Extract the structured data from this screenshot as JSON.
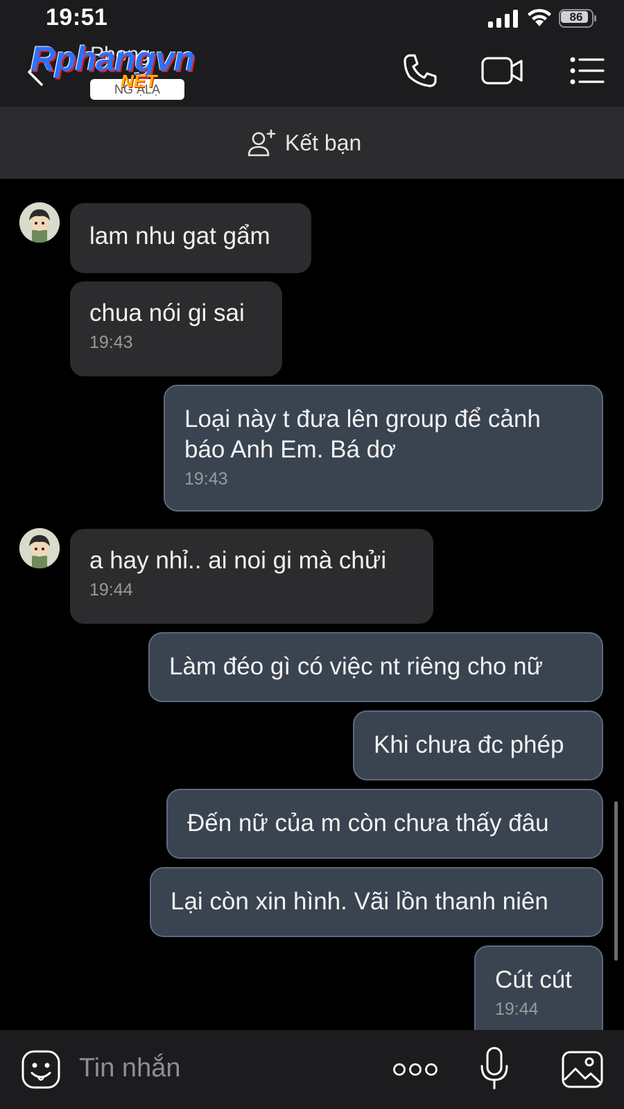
{
  "status_bar": {
    "time": "19:51",
    "battery": "86"
  },
  "header": {
    "contact_name": "Phong",
    "logo_text": "Rphangvn",
    "logo_badge": "NG      ẠLẠ",
    "logo_net": "NET"
  },
  "add_friend": {
    "label": "Kết bạn"
  },
  "messages": [
    {
      "dir": "in",
      "text": "lam nhu gat gẩm",
      "time": ""
    },
    {
      "dir": "in",
      "text": "chua nói gi sai",
      "time": "19:43"
    },
    {
      "dir": "out",
      "text": "Loại này t đưa lên group để cảnh báo Anh Em. Bá dơ",
      "time": "19:43"
    },
    {
      "dir": "in",
      "text": "a hay nhỉ.. ai noi gi mà chửi",
      "time": "19:44"
    },
    {
      "dir": "out",
      "text": "Làm đéo gì có việc nt riêng cho nữ",
      "time": ""
    },
    {
      "dir": "out",
      "text": "Khi chưa đc phép",
      "time": ""
    },
    {
      "dir": "out",
      "text": "Đến nữ của m còn chưa thấy đâu",
      "time": ""
    },
    {
      "dir": "out",
      "text": "Lại còn xin hình. Vãi lồn thanh niên",
      "time": ""
    },
    {
      "dir": "out",
      "text": "Cút cút",
      "time": "19:44"
    }
  ],
  "input": {
    "placeholder": "Tin nhắn"
  },
  "colors": {
    "background": "#000000",
    "bar": "#1c1c1e",
    "incoming_bubble": "#2c2c2e",
    "outgoing_bubble": "#3a4350",
    "outgoing_border": "#5a6a80"
  },
  "icons": [
    "back-icon",
    "phone-icon",
    "video-call-icon",
    "menu-icon",
    "add-friend-icon",
    "emoji-icon",
    "more-icon",
    "microphone-icon",
    "gallery-icon"
  ]
}
